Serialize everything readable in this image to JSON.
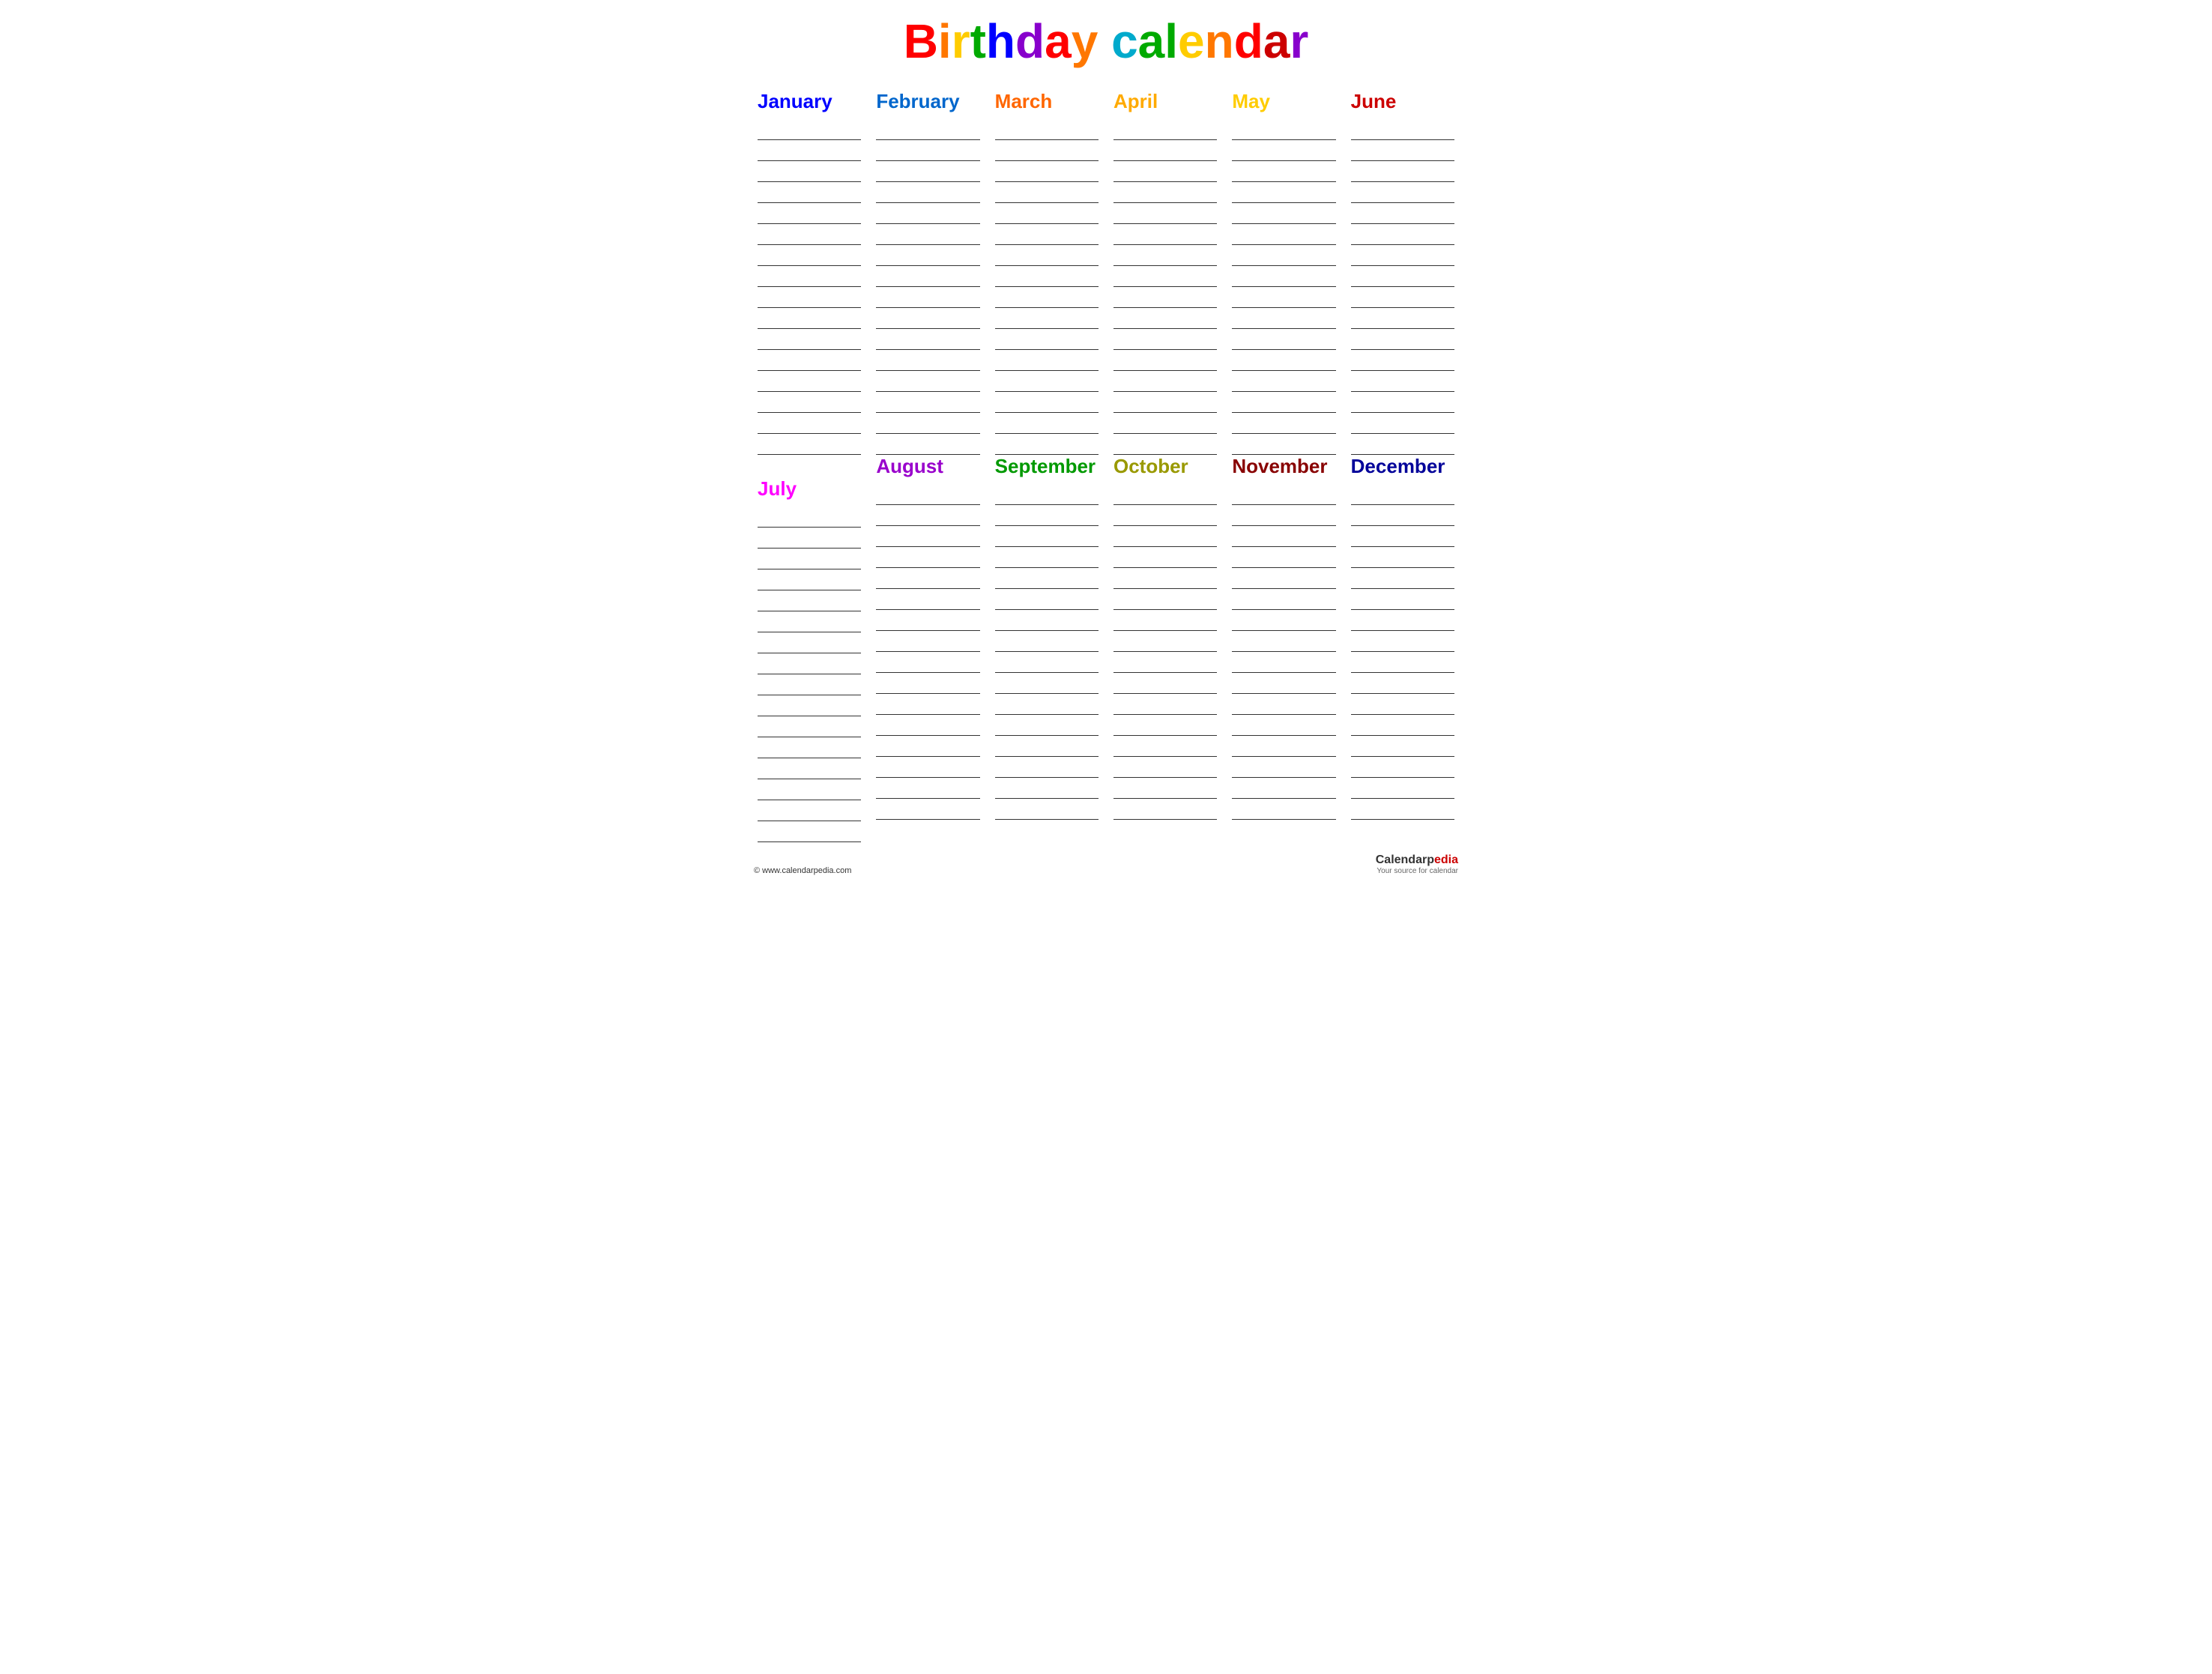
{
  "title": {
    "full": "Birthday calendar",
    "letters": [
      {
        "char": "B",
        "color": "#ff0000"
      },
      {
        "char": "i",
        "color": "#ff7700"
      },
      {
        "char": "r",
        "color": "#ffcc00"
      },
      {
        "char": "t",
        "color": "#00aa00"
      },
      {
        "char": "h",
        "color": "#0000ff"
      },
      {
        "char": "d",
        "color": "#8800cc"
      },
      {
        "char": "a",
        "color": "#ff0000"
      },
      {
        "char": "y",
        "color": "#ff7700"
      },
      {
        "char": " ",
        "color": "#000000"
      },
      {
        "char": "c",
        "color": "#00aacc"
      },
      {
        "char": "a",
        "color": "#00aa00"
      },
      {
        "char": "l",
        "color": "#00aa00"
      },
      {
        "char": "e",
        "color": "#ffcc00"
      },
      {
        "char": "n",
        "color": "#ff7700"
      },
      {
        "char": "d",
        "color": "#ff0000"
      },
      {
        "char": "a",
        "color": "#cc0000"
      },
      {
        "char": "r",
        "color": "#8800cc"
      }
    ]
  },
  "months": [
    {
      "name": "January",
      "color": "#0000ff",
      "lines": 16
    },
    {
      "name": "February",
      "color": "#0066cc",
      "lines": 16
    },
    {
      "name": "March",
      "color": "#ff6600",
      "lines": 16
    },
    {
      "name": "April",
      "color": "#ffaa00",
      "lines": 16
    },
    {
      "name": "May",
      "color": "#ffcc00",
      "lines": 16
    },
    {
      "name": "June",
      "color": "#cc0000",
      "lines": 16
    },
    {
      "name": "July",
      "color": "#ff00ff",
      "lines": 16
    },
    {
      "name": "August",
      "color": "#9900cc",
      "lines": 16
    },
    {
      "name": "September",
      "color": "#009900",
      "lines": 16
    },
    {
      "name": "October",
      "color": "#999900",
      "lines": 16
    },
    {
      "name": "November",
      "color": "#880000",
      "lines": 16
    },
    {
      "name": "December",
      "color": "#000099",
      "lines": 16
    }
  ],
  "footer": {
    "website": "© www.calendarpedia.com",
    "brand_name": "Calendarpedia",
    "brand_tagline": "Your source for calendar"
  }
}
